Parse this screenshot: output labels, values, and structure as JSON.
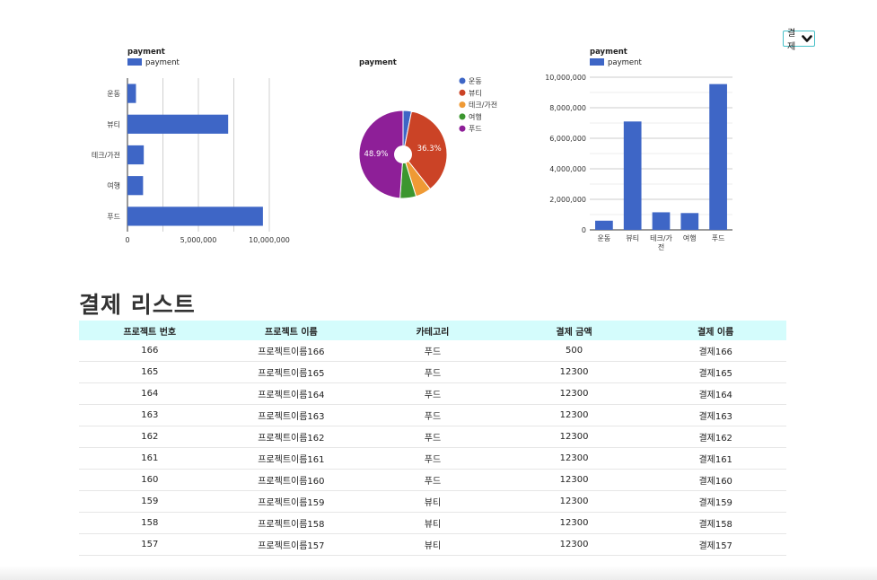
{
  "select": {
    "value": "결제",
    "icon": "chevron-down-icon"
  },
  "charts": {
    "bar_h": {
      "title": "payment",
      "legend": "payment"
    },
    "pie": {
      "title": "payment"
    },
    "bar_v": {
      "title": "payment",
      "legend": "payment"
    }
  },
  "colors": {
    "bar": "#3e66c6",
    "pie": [
      "#3e66c6",
      "#cb4326",
      "#ef9a35",
      "#3c962f",
      "#8e1f98"
    ],
    "table_header_bg": "#d4fcfc"
  },
  "chart_data": [
    {
      "type": "bar",
      "orientation": "horizontal",
      "title": "payment",
      "legend": [
        "payment"
      ],
      "legend_position": "top",
      "categories": [
        "운동",
        "뷰티",
        "테크/가전",
        "여행",
        "푸드"
      ],
      "series": [
        {
          "name": "payment",
          "values": [
            600000,
            7100000,
            1150000,
            1100000,
            9550000
          ]
        }
      ],
      "xlim": [
        0,
        10000000
      ],
      "xticks": [
        "0",
        "5,000,000",
        "10,000,000"
      ],
      "grid": true
    },
    {
      "type": "pie",
      "title": "payment",
      "legend_position": "right",
      "labels": [
        "운동",
        "뷰티",
        "테크/가전",
        "여행",
        "푸드"
      ],
      "values": [
        3.1,
        36.3,
        5.8,
        5.9,
        48.9
      ],
      "data_labels": [
        "",
        "36.3%",
        "",
        "",
        "48.9%"
      ],
      "hole": true
    },
    {
      "type": "bar",
      "orientation": "vertical",
      "title": "payment",
      "legend": [
        "payment"
      ],
      "legend_position": "top",
      "categories": [
        "운동",
        "뷰티",
        "테크/가전",
        "여행",
        "푸드"
      ],
      "series": [
        {
          "name": "payment",
          "values": [
            600000,
            7100000,
            1150000,
            1100000,
            9550000
          ]
        }
      ],
      "ylim": [
        0,
        10000000
      ],
      "yticks": [
        "0",
        "2,000,000",
        "4,000,000",
        "6,000,000",
        "8,000,000",
        "10,000,000"
      ],
      "grid": true
    }
  ],
  "payment_list": {
    "title": "결제 리스트",
    "columns": [
      "프로젝트 번호",
      "프로젝트 이름",
      "카테고리",
      "결제 금액",
      "결제 이름"
    ],
    "rows": [
      [
        "166",
        "프로젝트이름166",
        "푸드",
        "500",
        "결제166"
      ],
      [
        "165",
        "프로젝트이름165",
        "푸드",
        "12300",
        "결제165"
      ],
      [
        "164",
        "프로젝트이름164",
        "푸드",
        "12300",
        "결제164"
      ],
      [
        "163",
        "프로젝트이름163",
        "푸드",
        "12300",
        "결제163"
      ],
      [
        "162",
        "프로젝트이름162",
        "푸드",
        "12300",
        "결제162"
      ],
      [
        "161",
        "프로젝트이름161",
        "푸드",
        "12300",
        "결제161"
      ],
      [
        "160",
        "프로젝트이름160",
        "푸드",
        "12300",
        "결제160"
      ],
      [
        "159",
        "프로젝트이름159",
        "뷰티",
        "12300",
        "결제159"
      ],
      [
        "158",
        "프로젝트이름158",
        "뷰티",
        "12300",
        "결제158"
      ],
      [
        "157",
        "프로젝트이름157",
        "뷰티",
        "12300",
        "결제157"
      ]
    ]
  }
}
